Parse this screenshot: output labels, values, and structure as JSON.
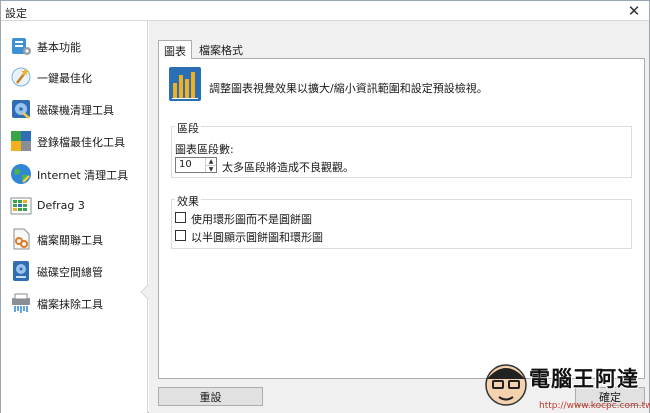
{
  "window": {
    "title": "設定",
    "close_glyph": "✕"
  },
  "sidebar": {
    "items": [
      {
        "label": "基本功能",
        "icon": "settings-tool-icon"
      },
      {
        "label": "一鍵最佳化",
        "icon": "magic-wand-icon"
      },
      {
        "label": "磁碟機清理工具",
        "icon": "disk-cleanup-icon"
      },
      {
        "label": "登錄檔最佳化工具",
        "icon": "registry-puzzle-icon"
      },
      {
        "label": "Internet 清理工具",
        "icon": "internet-globe-icon"
      },
      {
        "label": "Defrag 3",
        "icon": "defrag-grid-icon"
      },
      {
        "label": "檔案關聯工具",
        "icon": "file-link-icon"
      },
      {
        "label": "磁碟空間總管",
        "icon": "disk-space-icon"
      },
      {
        "label": "檔案抹除工具",
        "icon": "file-shredder-icon"
      }
    ],
    "selected_index": 7
  },
  "tabs": [
    {
      "label": "圖表",
      "active": true
    },
    {
      "label": "檔案格式",
      "active": false
    }
  ],
  "header": {
    "text": "調整圖表視覺效果以擴大/縮小資訊範圍和設定預設檢視。",
    "icon": "bar-chart-icon"
  },
  "segments_group": {
    "title": "區段",
    "field_label": "圖表區段數:",
    "value": "10",
    "hint": "太多區段將造成不良觀觀。"
  },
  "effects_group": {
    "title": "效果",
    "options": [
      {
        "label": "使用環形圖而不是圓餅圖",
        "checked": false
      },
      {
        "label": "以半圓顯示圓餅圖和環形圖",
        "checked": false
      }
    ]
  },
  "buttons": {
    "reset": "重設",
    "close": "確定"
  },
  "watermark": {
    "brand": "電腦王阿達",
    "url": "http://www.kocpc.com.tw"
  },
  "colors": {
    "accent_blue": "#2a6fb6",
    "panel_bg": "#f0f0f0",
    "watermark_red": "#c0392b"
  }
}
